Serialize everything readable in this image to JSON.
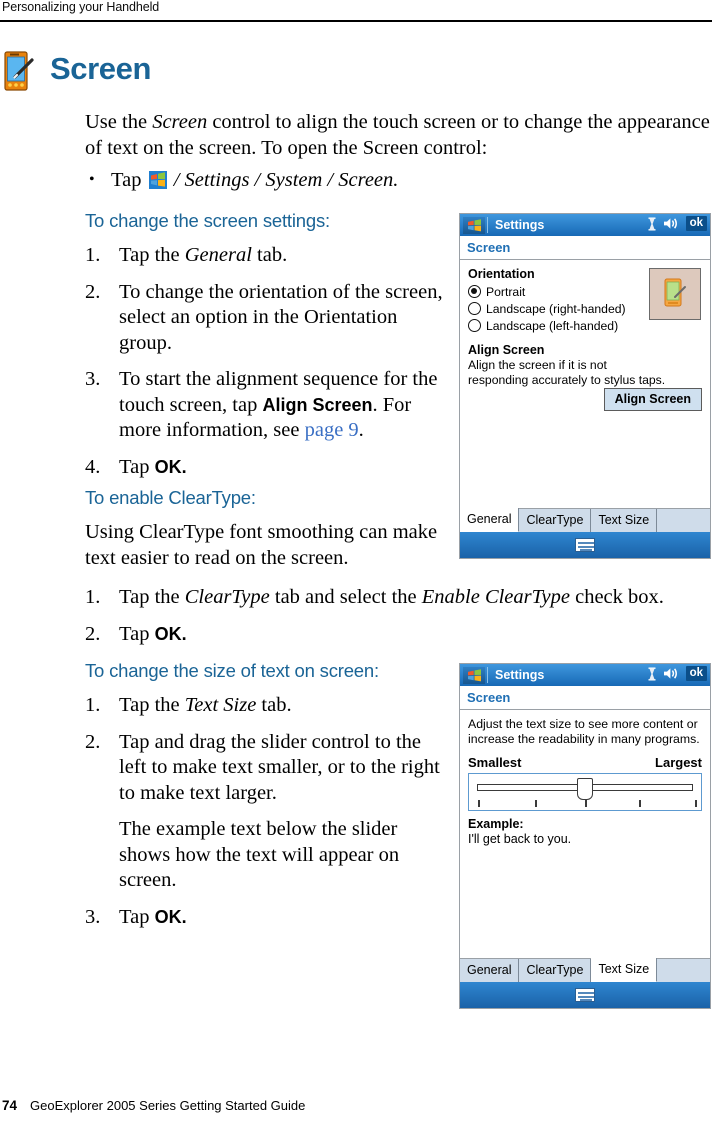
{
  "header": {
    "running_head": "Personalizing your Handheld"
  },
  "title": {
    "text": "Screen",
    "icon": "pda-stylus-icon",
    "color": "#1a6496"
  },
  "intro": {
    "line1_a": "Use the ",
    "line1_i": "Screen",
    "line1_b": " control to align the touch screen or to change the appearance of text on the screen. To open the Screen control:"
  },
  "bullet": {
    "tap": "Tap",
    "icon": "windows-start-icon",
    "path": "/ Settings / System / Screen."
  },
  "sections": [
    {
      "heading": "To change the screen settings:",
      "steps": [
        {
          "pre": "Tap the ",
          "em": "General",
          "post": " tab."
        },
        {
          "pre": "To change the orientation of the screen, select an option in the Orientation group."
        },
        {
          "pre": "To start the alignment sequence for the touch screen, tap ",
          "strong": "Align Screen",
          "mid": ". For more information, see ",
          "link": "page 9",
          "post": "."
        },
        {
          "pre": "Tap ",
          "strong": "OK."
        }
      ]
    },
    {
      "heading": "To enable ClearType:",
      "intro": "Using ClearType font smoothing can make text easier to read on the screen.",
      "steps": [
        {
          "pre": "Tap the ",
          "em": "ClearType",
          "mid": " tab and select the ",
          "em2": "Enable ClearType",
          "post": " check box."
        },
        {
          "pre": "Tap ",
          "strong": "OK."
        }
      ]
    },
    {
      "heading": "To change the size of text on screen:",
      "steps": [
        {
          "pre": "Tap the ",
          "em": "Text Size",
          "post": " tab."
        },
        {
          "pre": "Tap and drag the slider control to the left to make text smaller, or to the right to make text larger."
        },
        {
          "pre": "The example text below the slider shows how the text will appear on screen.",
          "nonum": true
        },
        {
          "pre": "Tap ",
          "strong": "OK."
        }
      ]
    }
  ],
  "device_general": {
    "titlebar": {
      "start_icon": "windows-start-icon",
      "title": "Settings",
      "status_icon": "hourglass-icon",
      "volume_icon": "speaker-icon",
      "ok_label": "ok"
    },
    "subtitle": "Screen",
    "orientation": {
      "group_label": "Orientation",
      "options": [
        {
          "label": "Portrait",
          "selected": true
        },
        {
          "label": "Landscape (right-handed)",
          "selected": false
        },
        {
          "label": "Landscape (left-handed)",
          "selected": false
        }
      ],
      "preview_icon": "orientation-preview-icon"
    },
    "align": {
      "title": "Align Screen",
      "description": "Align the screen if it is not responding accurately to stylus taps.",
      "button_label": "Align Screen"
    },
    "tabs": [
      {
        "label": "General",
        "active": true
      },
      {
        "label": "ClearType",
        "active": false
      },
      {
        "label": "Text Size",
        "active": false
      }
    ],
    "taskbar_icon": "keyboard-icon"
  },
  "device_textsize": {
    "titlebar": {
      "start_icon": "windows-start-icon",
      "title": "Settings",
      "status_icon": "hourglass-icon",
      "volume_icon": "speaker-icon",
      "ok_label": "ok"
    },
    "subtitle": "Screen",
    "description": "Adjust the text size to see more content or increase the readability in many programs.",
    "slider": {
      "min_label": "Smallest",
      "max_label": "Largest",
      "value_percent": 50,
      "tick_count": 5
    },
    "example": {
      "label": "Example:",
      "text": "I'll get back to you."
    },
    "tabs": [
      {
        "label": "General",
        "active": false
      },
      {
        "label": "ClearType",
        "active": false
      },
      {
        "label": "Text Size",
        "active": true
      }
    ],
    "taskbar_icon": "keyboard-icon"
  },
  "footer": {
    "page_number": "74",
    "guide_title": "GeoExplorer 2005 Series Getting Started Guide"
  }
}
